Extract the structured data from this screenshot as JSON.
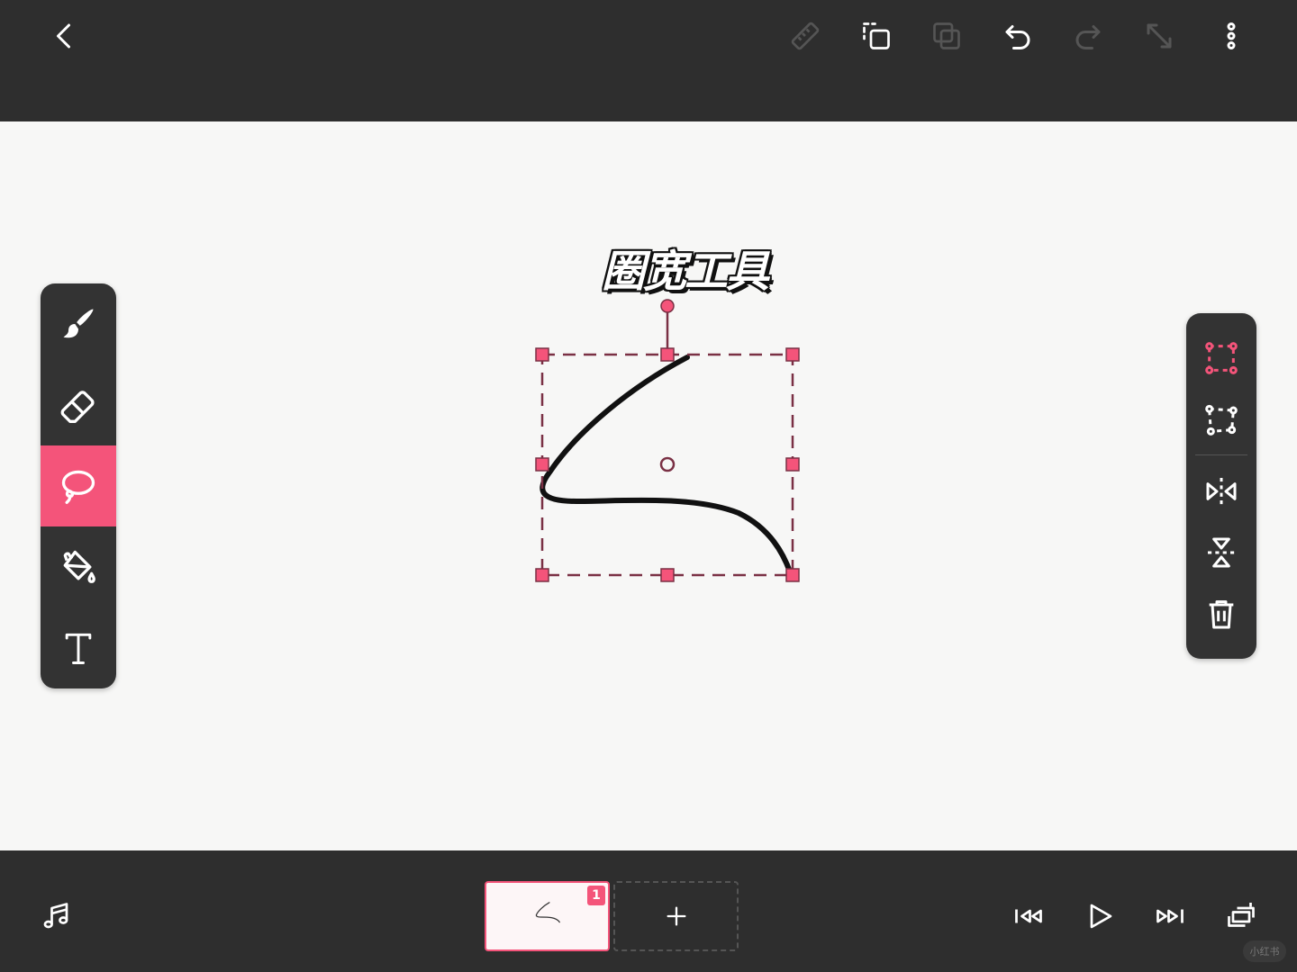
{
  "canvas": {
    "title": "圈宽工具"
  },
  "top_toolbar": {
    "icons": [
      "back-icon",
      "ruler-icon",
      "select-copy-icon",
      "duplicate-icon",
      "undo-icon",
      "redo-icon",
      "fullscreen-icon",
      "more-icon"
    ]
  },
  "left_toolbar": {
    "tools": [
      "brush-icon",
      "eraser-icon",
      "lasso-icon",
      "paint-bucket-icon",
      "text-icon"
    ],
    "active_tool": "lasso-icon"
  },
  "right_toolbar": {
    "tools": [
      "rect-select-icon",
      "free-transform-icon",
      "flip-horizontal-icon",
      "flip-vertical-icon",
      "delete-icon"
    ]
  },
  "timeline": {
    "frame_badge": "1",
    "add_frame_label": "+"
  },
  "watermark": "小红书",
  "colors": {
    "accent": "#f4547a",
    "bar_bg": "#2e2e2e",
    "panel_bg": "#333333",
    "canvas_bg": "#f7f7f6"
  }
}
